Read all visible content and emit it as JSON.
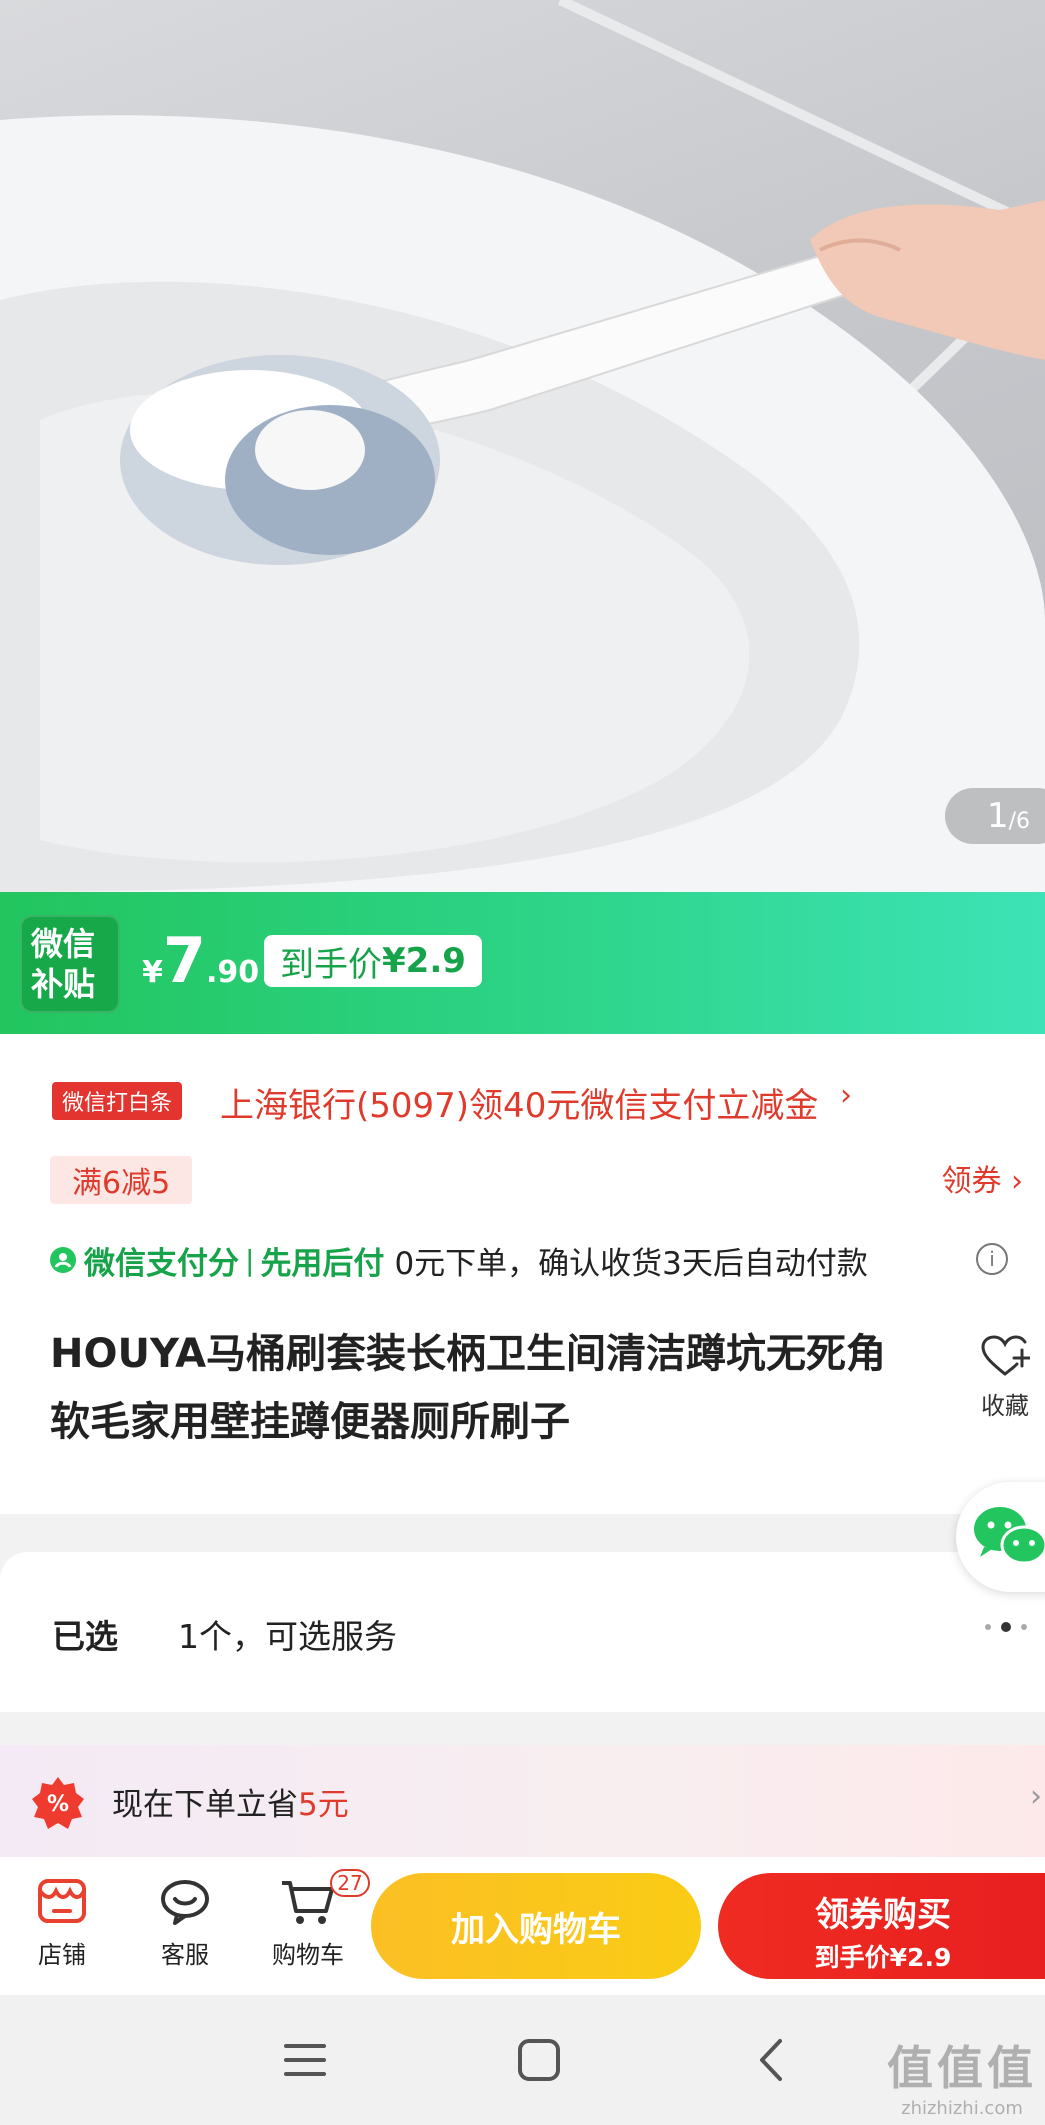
{
  "gallery": {
    "current": "1",
    "total": "/6"
  },
  "price_banner": {
    "badge_line1": "微信",
    "badge_line2": "补贴",
    "currency": "¥",
    "price_int": "7",
    "price_dec": ".90",
    "final_label": "到手价",
    "final_value": "¥2.9"
  },
  "promo": {
    "bank_tag": "微信打白条",
    "bank_text": "上海银行(5097)领40元微信支付立减金",
    "chevron": "›",
    "discount_tag": "满6减5",
    "coupon_link": "领券 ›"
  },
  "pay": {
    "brand": "微信支付分",
    "separator": "|",
    "mode": "先用后付",
    "desc": "0元下单，确认收货3天后自动付款",
    "info_icon": "i"
  },
  "product": {
    "title": "HOUYA马桶刷套装长柄卫生间清洁蹲坑无死角软毛家用壁挂蹲便器厕所刷子",
    "favorite_label": "收藏"
  },
  "selection": {
    "label": "已选",
    "value": "1个，可选服务"
  },
  "saving": {
    "prefix": "现在下单立省",
    "amount": "5元",
    "chevron": "›"
  },
  "actions": {
    "store": "店铺",
    "service": "客服",
    "cart": "购物车",
    "cart_count": "27",
    "add_to_cart": "加入购物车",
    "buy_main": "领券购买",
    "buy_sub": "到手价¥2.9"
  },
  "watermark": {
    "big": "值值值",
    "small": "zhizhizhi.com"
  },
  "colors": {
    "green": "#22c55e",
    "red": "#e03a2c",
    "yellow": "#fbbf24"
  },
  "icons": [
    "shop-icon",
    "customer-service-icon",
    "cart-icon",
    "heart-plus-icon",
    "wechat-icon",
    "discount-icon",
    "menu-icon",
    "home-icon",
    "back-icon"
  ]
}
